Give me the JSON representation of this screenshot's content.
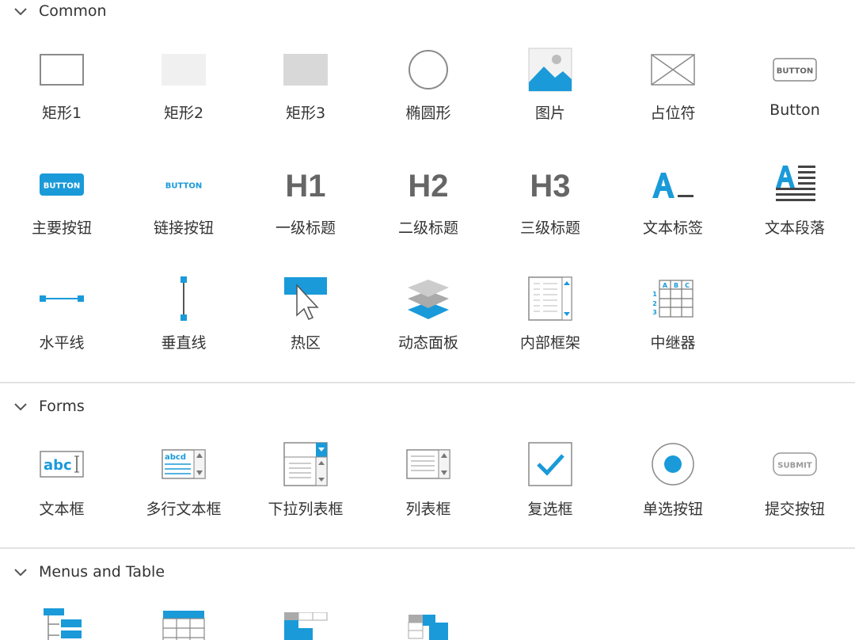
{
  "sections": {
    "common": {
      "title": "Common",
      "widgets": [
        {
          "label": "矩形1",
          "icon": "rectangle-outline-icon"
        },
        {
          "label": "矩形2",
          "icon": "rectangle-light-fill-icon"
        },
        {
          "label": "矩形3",
          "icon": "rectangle-gray-fill-icon"
        },
        {
          "label": "椭圆形",
          "icon": "ellipse-icon"
        },
        {
          "label": "图片",
          "icon": "image-icon"
        },
        {
          "label": "占位符",
          "icon": "placeholder-icon"
        },
        {
          "label": "Button",
          "icon": "button-icon"
        },
        {
          "label": "主要按钮",
          "icon": "primary-button-icon"
        },
        {
          "label": "链接按钮",
          "icon": "link-button-icon"
        },
        {
          "label": "一级标题",
          "icon": "heading-1-icon"
        },
        {
          "label": "二级标题",
          "icon": "heading-2-icon"
        },
        {
          "label": "三级标题",
          "icon": "heading-3-icon"
        },
        {
          "label": "文本标签",
          "icon": "text-label-icon"
        },
        {
          "label": "文本段落",
          "icon": "text-paragraph-icon"
        },
        {
          "label": "水平线",
          "icon": "horizontal-line-icon"
        },
        {
          "label": "垂直线",
          "icon": "vertical-line-icon"
        },
        {
          "label": "热区",
          "icon": "hotspot-icon"
        },
        {
          "label": "动态面板",
          "icon": "dynamic-panel-icon"
        },
        {
          "label": "内部框架",
          "icon": "inline-frame-icon"
        },
        {
          "label": "中继器",
          "icon": "repeater-icon"
        }
      ]
    },
    "forms": {
      "title": "Forms",
      "widgets": [
        {
          "label": "文本框",
          "icon": "text-field-icon"
        },
        {
          "label": "多行文本框",
          "icon": "text-area-icon"
        },
        {
          "label": "下拉列表框",
          "icon": "droplist-icon"
        },
        {
          "label": "列表框",
          "icon": "list-box-icon"
        },
        {
          "label": "复选框",
          "icon": "checkbox-icon"
        },
        {
          "label": "单选按钮",
          "icon": "radio-button-icon"
        },
        {
          "label": "提交按钮",
          "icon": "submit-button-icon"
        }
      ]
    },
    "menus": {
      "title": "Menus and Table",
      "widgets": [
        {
          "label": "",
          "icon": "tree-icon"
        },
        {
          "label": "",
          "icon": "table-icon"
        },
        {
          "label": "",
          "icon": "horizontal-menu-icon"
        },
        {
          "label": "",
          "icon": "vertical-menu-icon"
        }
      ]
    }
  },
  "icon_text": {
    "button": "BUTTON",
    "submit": "SUBMIT",
    "h1": "H1",
    "h2": "H2",
    "h3": "H3",
    "abc": "abc",
    "abcd": "abcd"
  },
  "colors": {
    "accent": "#1a9ad9",
    "gray_text": "#666666",
    "divider": "#e2e2e2"
  }
}
